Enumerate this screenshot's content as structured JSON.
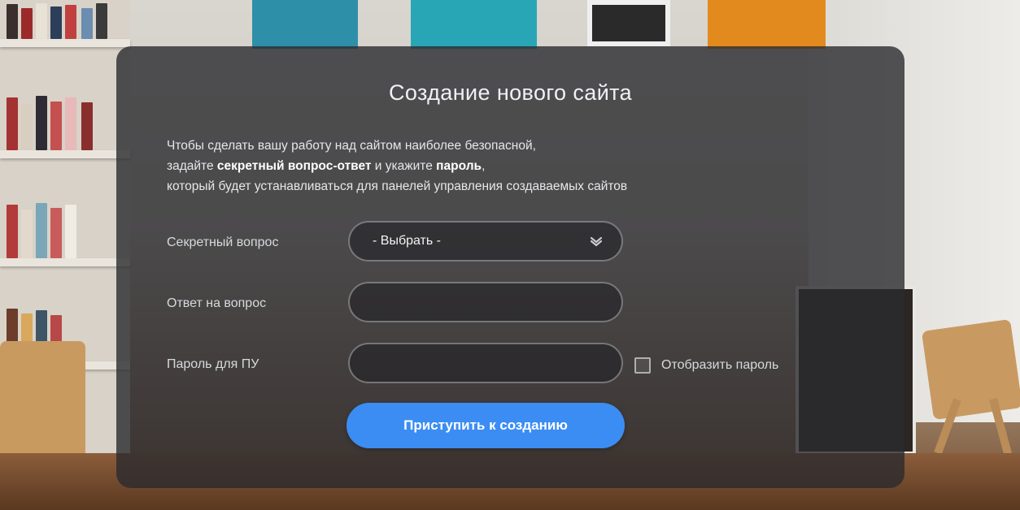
{
  "modal": {
    "title": "Создание нового сайта",
    "description": {
      "line1": "Чтобы сделать вашу работу над сайтом наиболее безопасной,",
      "line2_pre": "задайте ",
      "line2_bold1": "секретный вопрос-ответ",
      "line2_mid": " и укажите ",
      "line2_bold2": "пароль",
      "line2_post": ",",
      "line3": "который будет устанавливаться для панелей управления создаваемых сайтов"
    },
    "secret_question": {
      "label": "Секретный вопрос",
      "selected": "- Выбрать -",
      "icon": "chevron-down-icon"
    },
    "answer": {
      "label": "Ответ на вопрос",
      "value": ""
    },
    "password": {
      "label": "Пароль для ПУ",
      "value": ""
    },
    "show_password": {
      "label": "Отобразить пароль",
      "checked": false
    },
    "submit_label": "Приступить к созданию"
  },
  "colors": {
    "accent": "#3b8df3",
    "modal_bg": "rgba(42,42,46,0.80)"
  }
}
